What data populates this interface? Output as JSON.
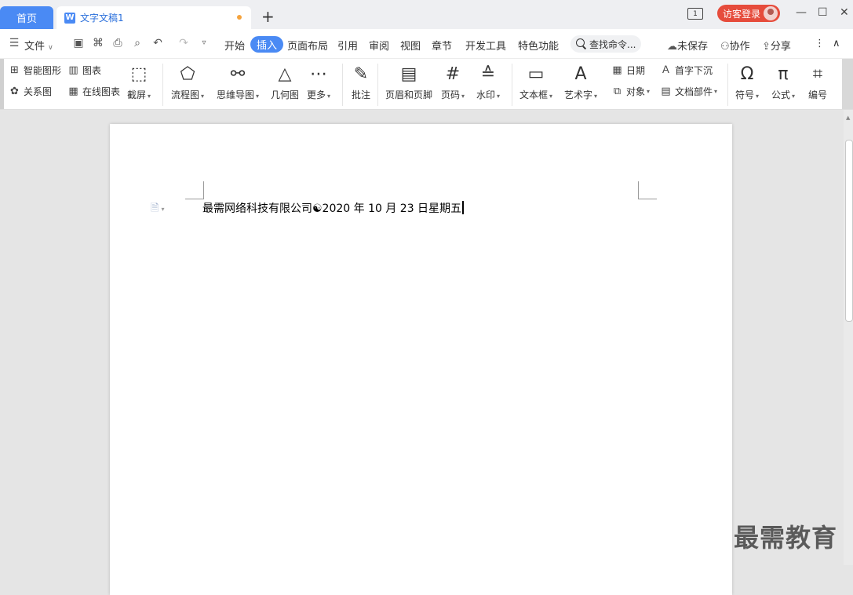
{
  "tabs": {
    "home": "首页",
    "doc_title": "文字文稿1",
    "add": "+"
  },
  "window": {
    "page_indicator": "1",
    "login": "访客登录",
    "minimize": "—",
    "maximize": "☐",
    "close": "✕"
  },
  "menu": {
    "file": "文件",
    "items": [
      "开始",
      "插入",
      "页面布局",
      "引用",
      "审阅",
      "视图",
      "章节",
      "开发工具",
      "特色功能"
    ],
    "search": "查找命令...",
    "unsaved": "未保存",
    "collab": "协作",
    "share": "分享"
  },
  "ribbon": {
    "smart_graphic": "智能图形",
    "chart": "图表",
    "relation": "关系图",
    "online_chart": "在线图表",
    "screenshot": "截屏",
    "flowchart": "流程图",
    "mindmap": "思维导图",
    "geometry": "几何图",
    "more": "更多",
    "comment": "批注",
    "header_footer": "页眉和页脚",
    "page_number": "页码",
    "watermark": "水印",
    "textbox": "文本框",
    "wordart": "艺术字",
    "date": "日期",
    "object": "对象",
    "dropcap": "首字下沉",
    "doc_parts": "文档部件",
    "symbol": "符号",
    "formula": "公式",
    "numbering": "编号"
  },
  "document": {
    "line": "最需网络科技有限公司☯2020 年 10 月 23 日星期五"
  },
  "overlay": {
    "brand": "最需教育"
  }
}
